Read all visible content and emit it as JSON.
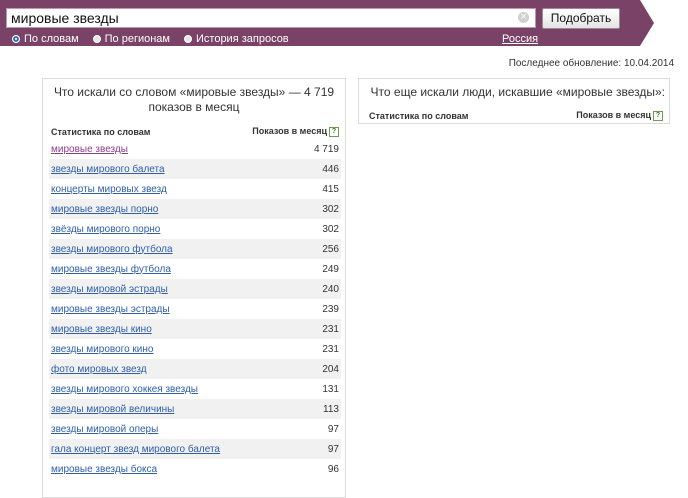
{
  "search": {
    "query": "мировые звезды",
    "clear_glyph": "×",
    "submit_label": "Подобрать"
  },
  "modes": [
    {
      "label": "По словам",
      "selected": true
    },
    {
      "label": "По регионам",
      "selected": false
    },
    {
      "label": "История запросов",
      "selected": false
    }
  ],
  "region": "Россия",
  "last_update": "Последнее обновление: 10.04.2014",
  "left_panel": {
    "title": "Что искали со словом «мировые звезды» — 4 719 показов в месяц",
    "col_phrase": "Статистика по словам",
    "col_count": "Показов в месяц",
    "help_glyph": "?",
    "rows": [
      {
        "phrase": "мировые звезды",
        "count": "4 719"
      },
      {
        "phrase": "звезды мирового балета",
        "count": "446"
      },
      {
        "phrase": "концерты мировых звезд",
        "count": "415"
      },
      {
        "phrase": "мировые звезды порно",
        "count": "302"
      },
      {
        "phrase": "звёзды мирового порно",
        "count": "302"
      },
      {
        "phrase": "звезды мирового футбола",
        "count": "256"
      },
      {
        "phrase": "мировые звезды футбола",
        "count": "249"
      },
      {
        "phrase": "звезды мировой эстрады",
        "count": "240"
      },
      {
        "phrase": "мировые звезды эстрады",
        "count": "239"
      },
      {
        "phrase": "мировые звезды кино",
        "count": "231"
      },
      {
        "phrase": "звезды мирового кино",
        "count": "231"
      },
      {
        "phrase": "фото мировых звезд",
        "count": "204"
      },
      {
        "phrase": "звезды мирового хоккея звезды",
        "count": "131"
      },
      {
        "phrase": "звезды мировой величины",
        "count": "113"
      },
      {
        "phrase": "звезды мировой оперы",
        "count": "97"
      },
      {
        "phrase": "гала концерт звезд мирового балета",
        "count": "97"
      },
      {
        "phrase": "мировые звезды бокса",
        "count": "96"
      }
    ]
  },
  "right_panel": {
    "title": "Что еще искали люди, искавшие «мировые звезды»:",
    "col_phrase": "Статистика по словам",
    "col_count": "Показов в месяц",
    "help_glyph": "?"
  },
  "colors": {
    "header": "#7a4266",
    "link": "#2f5fa8",
    "visited_link": "#8a3f88"
  }
}
